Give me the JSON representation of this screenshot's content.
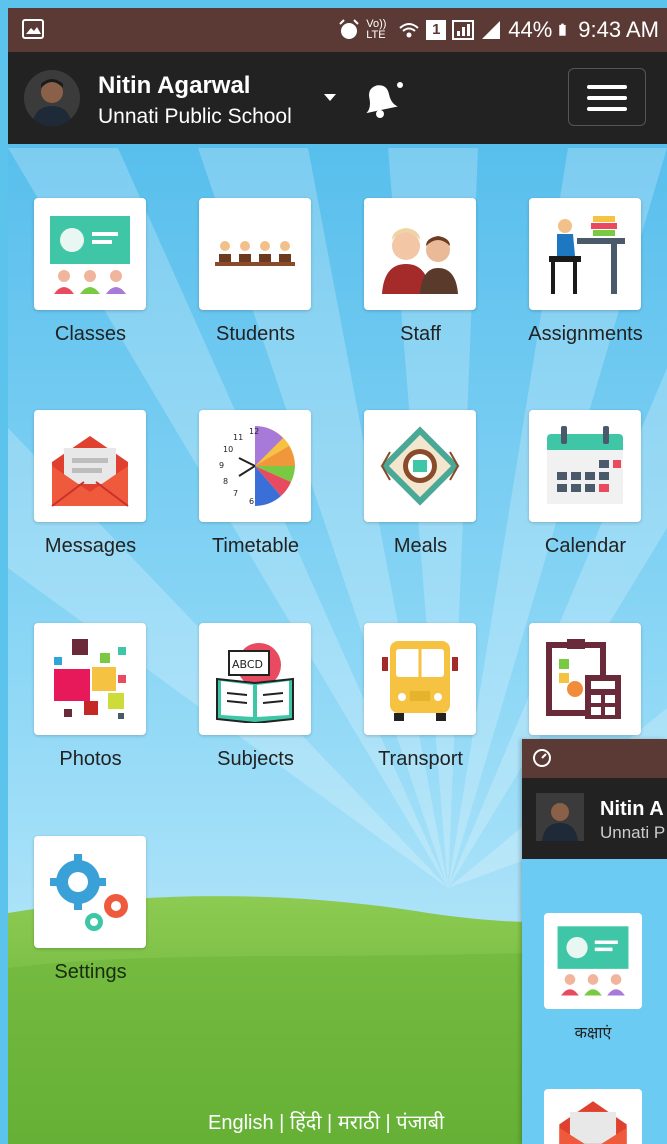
{
  "status_bar": {
    "network_label": "Vo)) LTE",
    "sim_badge": "1",
    "battery": "44%",
    "time": "9:43 AM",
    "icons": [
      "image-icon",
      "alarm-icon",
      "wifi-icon",
      "signal-icon",
      "battery-icon"
    ]
  },
  "header": {
    "user_name": "Nitin Agarwal",
    "school_name": "Unnati Public School",
    "icons": [
      "avatar",
      "chevron-down-icon",
      "bell-icon",
      "hamburger-menu-icon"
    ]
  },
  "menu_tiles": [
    {
      "label": "Classes",
      "icon": "classroom-icon"
    },
    {
      "label": "Students",
      "icon": "students-icon"
    },
    {
      "label": "Staff",
      "icon": "staff-icon"
    },
    {
      "label": "Assignments",
      "icon": "assignments-icon"
    },
    {
      "label": "Messages",
      "icon": "envelope-icon"
    },
    {
      "label": "Timetable",
      "icon": "clock-icon"
    },
    {
      "label": "Meals",
      "icon": "meal-icon"
    },
    {
      "label": "Calendar",
      "icon": "calendar-icon"
    },
    {
      "label": "Photos",
      "icon": "photos-icon"
    },
    {
      "label": "Subjects",
      "icon": "book-icon"
    },
    {
      "label": "Transport",
      "icon": "bus-icon"
    },
    {
      "label": "",
      "icon": "reports-icon"
    },
    {
      "label": "Settings",
      "icon": "gears-icon"
    }
  ],
  "language_bar": "English | हिंदी | मराठी | पंजाबी",
  "overlay_preview": {
    "user_name": "Nitin A",
    "school_name": "Unnati P",
    "tile_label": "कक्षाएं"
  },
  "colors": {
    "status_bar": "#5b3a35",
    "app_bar": "#222222",
    "sky": "#6ccbf2",
    "grass": "#7cc242"
  }
}
